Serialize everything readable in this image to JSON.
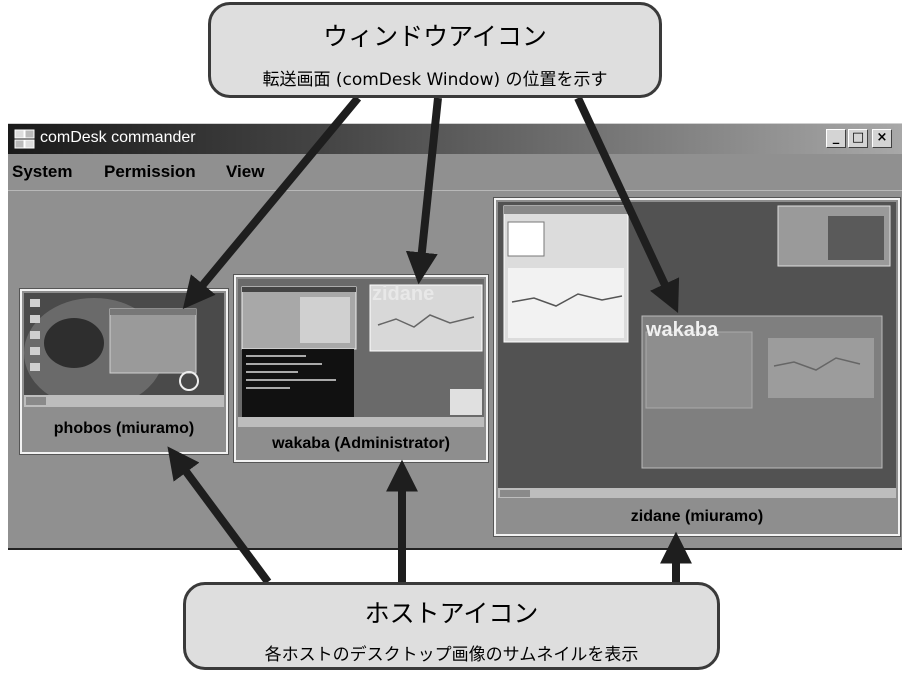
{
  "window": {
    "title": "comDesk commander",
    "controls": [
      "_",
      "□",
      "×"
    ]
  },
  "menu": [
    "System",
    "Permission",
    "View"
  ],
  "hosts": [
    {
      "label": "phobos (miuramo)"
    },
    {
      "label": "wakaba (Administrator)",
      "window_overlay": "zidane"
    },
    {
      "label": "zidane (miuramo)",
      "window_overlay": "wakaba"
    }
  ],
  "callouts": {
    "window_icon": {
      "title": "ウィンドウアイコン",
      "subtitle": "転送画面 (comDesk Window) の位置を示す"
    },
    "host_icon": {
      "title": "ホストアイコン",
      "subtitle": "各ホストのデスクトップ画像のサムネイルを表示"
    }
  },
  "colors": {
    "window_bg": "#909090",
    "titlebar_dark": "#1a1a1a",
    "callout_bg": "#dedede",
    "arrow": "#1e1e1e"
  }
}
